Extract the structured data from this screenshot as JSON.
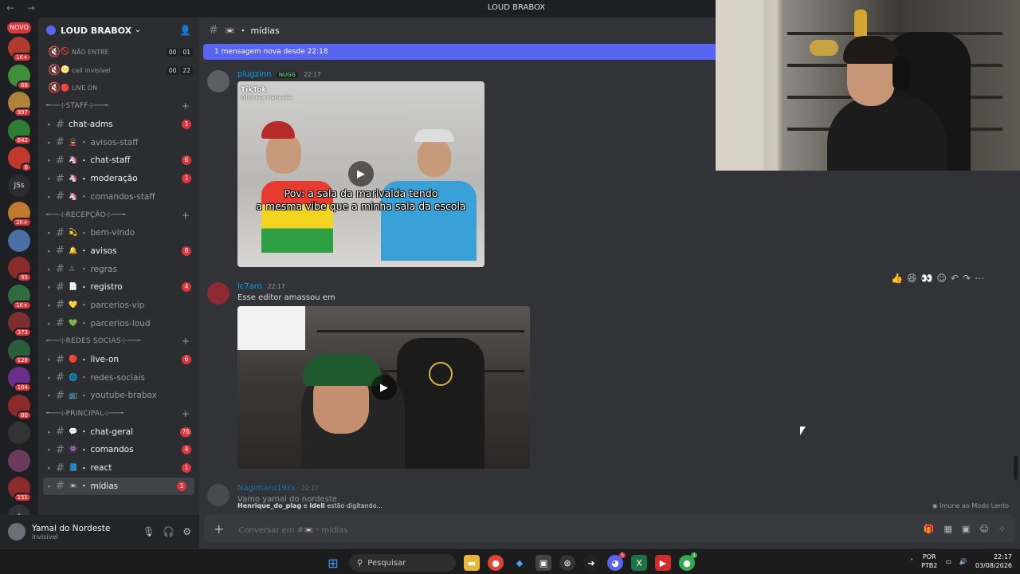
{
  "window": {
    "title": "LOUD BRABOX",
    "nav": "← →"
  },
  "servers": {
    "novo_label": "NOVO",
    "items": [
      {
        "label": "",
        "badge": "1K+"
      },
      {
        "label": "",
        "badge": "68"
      },
      {
        "label": "",
        "badge": "997"
      },
      {
        "label": "",
        "badge": "642"
      },
      {
        "label": "",
        "badge": "6"
      },
      {
        "label": "JSs",
        "badge": ""
      },
      {
        "label": "",
        "badge": "2K+"
      },
      {
        "label": "",
        "badge": ""
      },
      {
        "label": "",
        "badge": "95"
      },
      {
        "label": "",
        "badge": "1K+"
      },
      {
        "label": "",
        "badge": "373"
      },
      {
        "label": "",
        "badge": "128"
      },
      {
        "label": "",
        "badge": "104"
      },
      {
        "label": "",
        "badge": "80"
      },
      {
        "label": "",
        "badge": ""
      },
      {
        "label": "",
        "badge": ""
      },
      {
        "label": "",
        "badge": "151"
      }
    ],
    "add_icon": "+",
    "discover_icon": "⊘"
  },
  "guild": {
    "name": "LOUD BRABOX",
    "chevron": "⌄",
    "invite_icon": "person-add-icon"
  },
  "voice_channels": [
    {
      "name": "NÃO ENTRE",
      "emoji": "🚫",
      "count_a": "00",
      "count_b": "01"
    },
    {
      "name": "call invisível",
      "emoji": "🌝",
      "count_a": "00",
      "count_b": "22"
    },
    {
      "name": "LIVE ON",
      "emoji": "🔴",
      "count_a": "",
      "count_b": ""
    }
  ],
  "categories": {
    "staff": "╾──⊹STAFF⊹──╼",
    "recepcao": "╾──⊹RECEPÇÃO⊹──╼",
    "redes": "╾──⊹REDES SOCIAS⊹──╼",
    "principal": "╾──⊹PRINCIPAL⊹──╼"
  },
  "channels": {
    "staff": [
      {
        "name": "chat-adms",
        "emoji": "",
        "count": "1"
      },
      {
        "name": "avisos-staff",
        "emoji": "💂",
        "count": ""
      },
      {
        "name": "chat-staff",
        "emoji": "🦄",
        "count": "6"
      },
      {
        "name": "moderação",
        "emoji": "🦄",
        "count": "1"
      },
      {
        "name": "comandos-staff",
        "emoji": "🦄",
        "count": ""
      }
    ],
    "recepcao": [
      {
        "name": "bem-vindo",
        "emoji": "💫",
        "count": ""
      },
      {
        "name": "avisos",
        "emoji": "🔔",
        "count": "8"
      },
      {
        "name": "regras",
        "emoji": "⚠",
        "count": ""
      },
      {
        "name": "registro",
        "emoji": "📄",
        "count": "4"
      },
      {
        "name": "parcerios-vip",
        "emoji": "💛",
        "count": ""
      },
      {
        "name": "parcerios-loud",
        "emoji": "💚",
        "count": ""
      }
    ],
    "redes": [
      {
        "name": "live-on",
        "emoji": "🔴",
        "count": "6"
      },
      {
        "name": "redes-sociais",
        "emoji": "🌐",
        "count": ""
      },
      {
        "name": "youtube-brabox",
        "emoji": "📺",
        "count": ""
      }
    ],
    "principal": [
      {
        "name": "chat-geral",
        "emoji": "💬",
        "count": "76"
      },
      {
        "name": "comandos",
        "emoji": "👾",
        "count": "4"
      },
      {
        "name": "react",
        "emoji": "📘",
        "count": "1"
      },
      {
        "name": "mídias",
        "emoji": "📼",
        "count": "1"
      }
    ]
  },
  "user": {
    "name": "Yamal do Nordeste",
    "status": "Invisível"
  },
  "header": {
    "channel": "mídias",
    "emoji": "📼"
  },
  "new_messages_bar": "1 mensagem nova desde 22:18",
  "messages": [
    {
      "author": "plugzinn",
      "tag": "NUGG",
      "time": "22:17",
      "text": ""
    },
    {
      "author": "lc7aro",
      "tag": "",
      "time": "22:17",
      "text": "Esse editor amassou em"
    },
    {
      "author": "Nagimaru19zx",
      "tag": "",
      "time": "22:17",
      "text": "Vamo yamal do nordeste"
    }
  ],
  "video1": {
    "tiktok_label": "TikTok",
    "tiktok_handle": "@boneca.marivalda",
    "caption_line1": "Pov: a sala da marivalda tendo",
    "caption_line2": "a mesma vibe que a minha sala da escola"
  },
  "typing": {
    "users": "Henrique_do_plag",
    "joiner": "e",
    "user2": "Idell",
    "suffix": "estão digitando..."
  },
  "slowmode": "Imune ao Modo Lento",
  "composer": {
    "placeholder": "Conversar em #📼・mídias"
  },
  "hover_tools": [
    "👍",
    "😆",
    "👀",
    "☺",
    "↶",
    "↷",
    "⋯"
  ],
  "taskbar": {
    "search": "Pesquisar",
    "lang1": "POR",
    "lang2": "PTB2",
    "time": "22:17",
    "date": "03/08/2026",
    "discord_badge": "5",
    "chrome_badge": "1"
  },
  "colors": {
    "accent": "#5865f2",
    "badge": "#da373c",
    "link": "#00a8fc"
  }
}
